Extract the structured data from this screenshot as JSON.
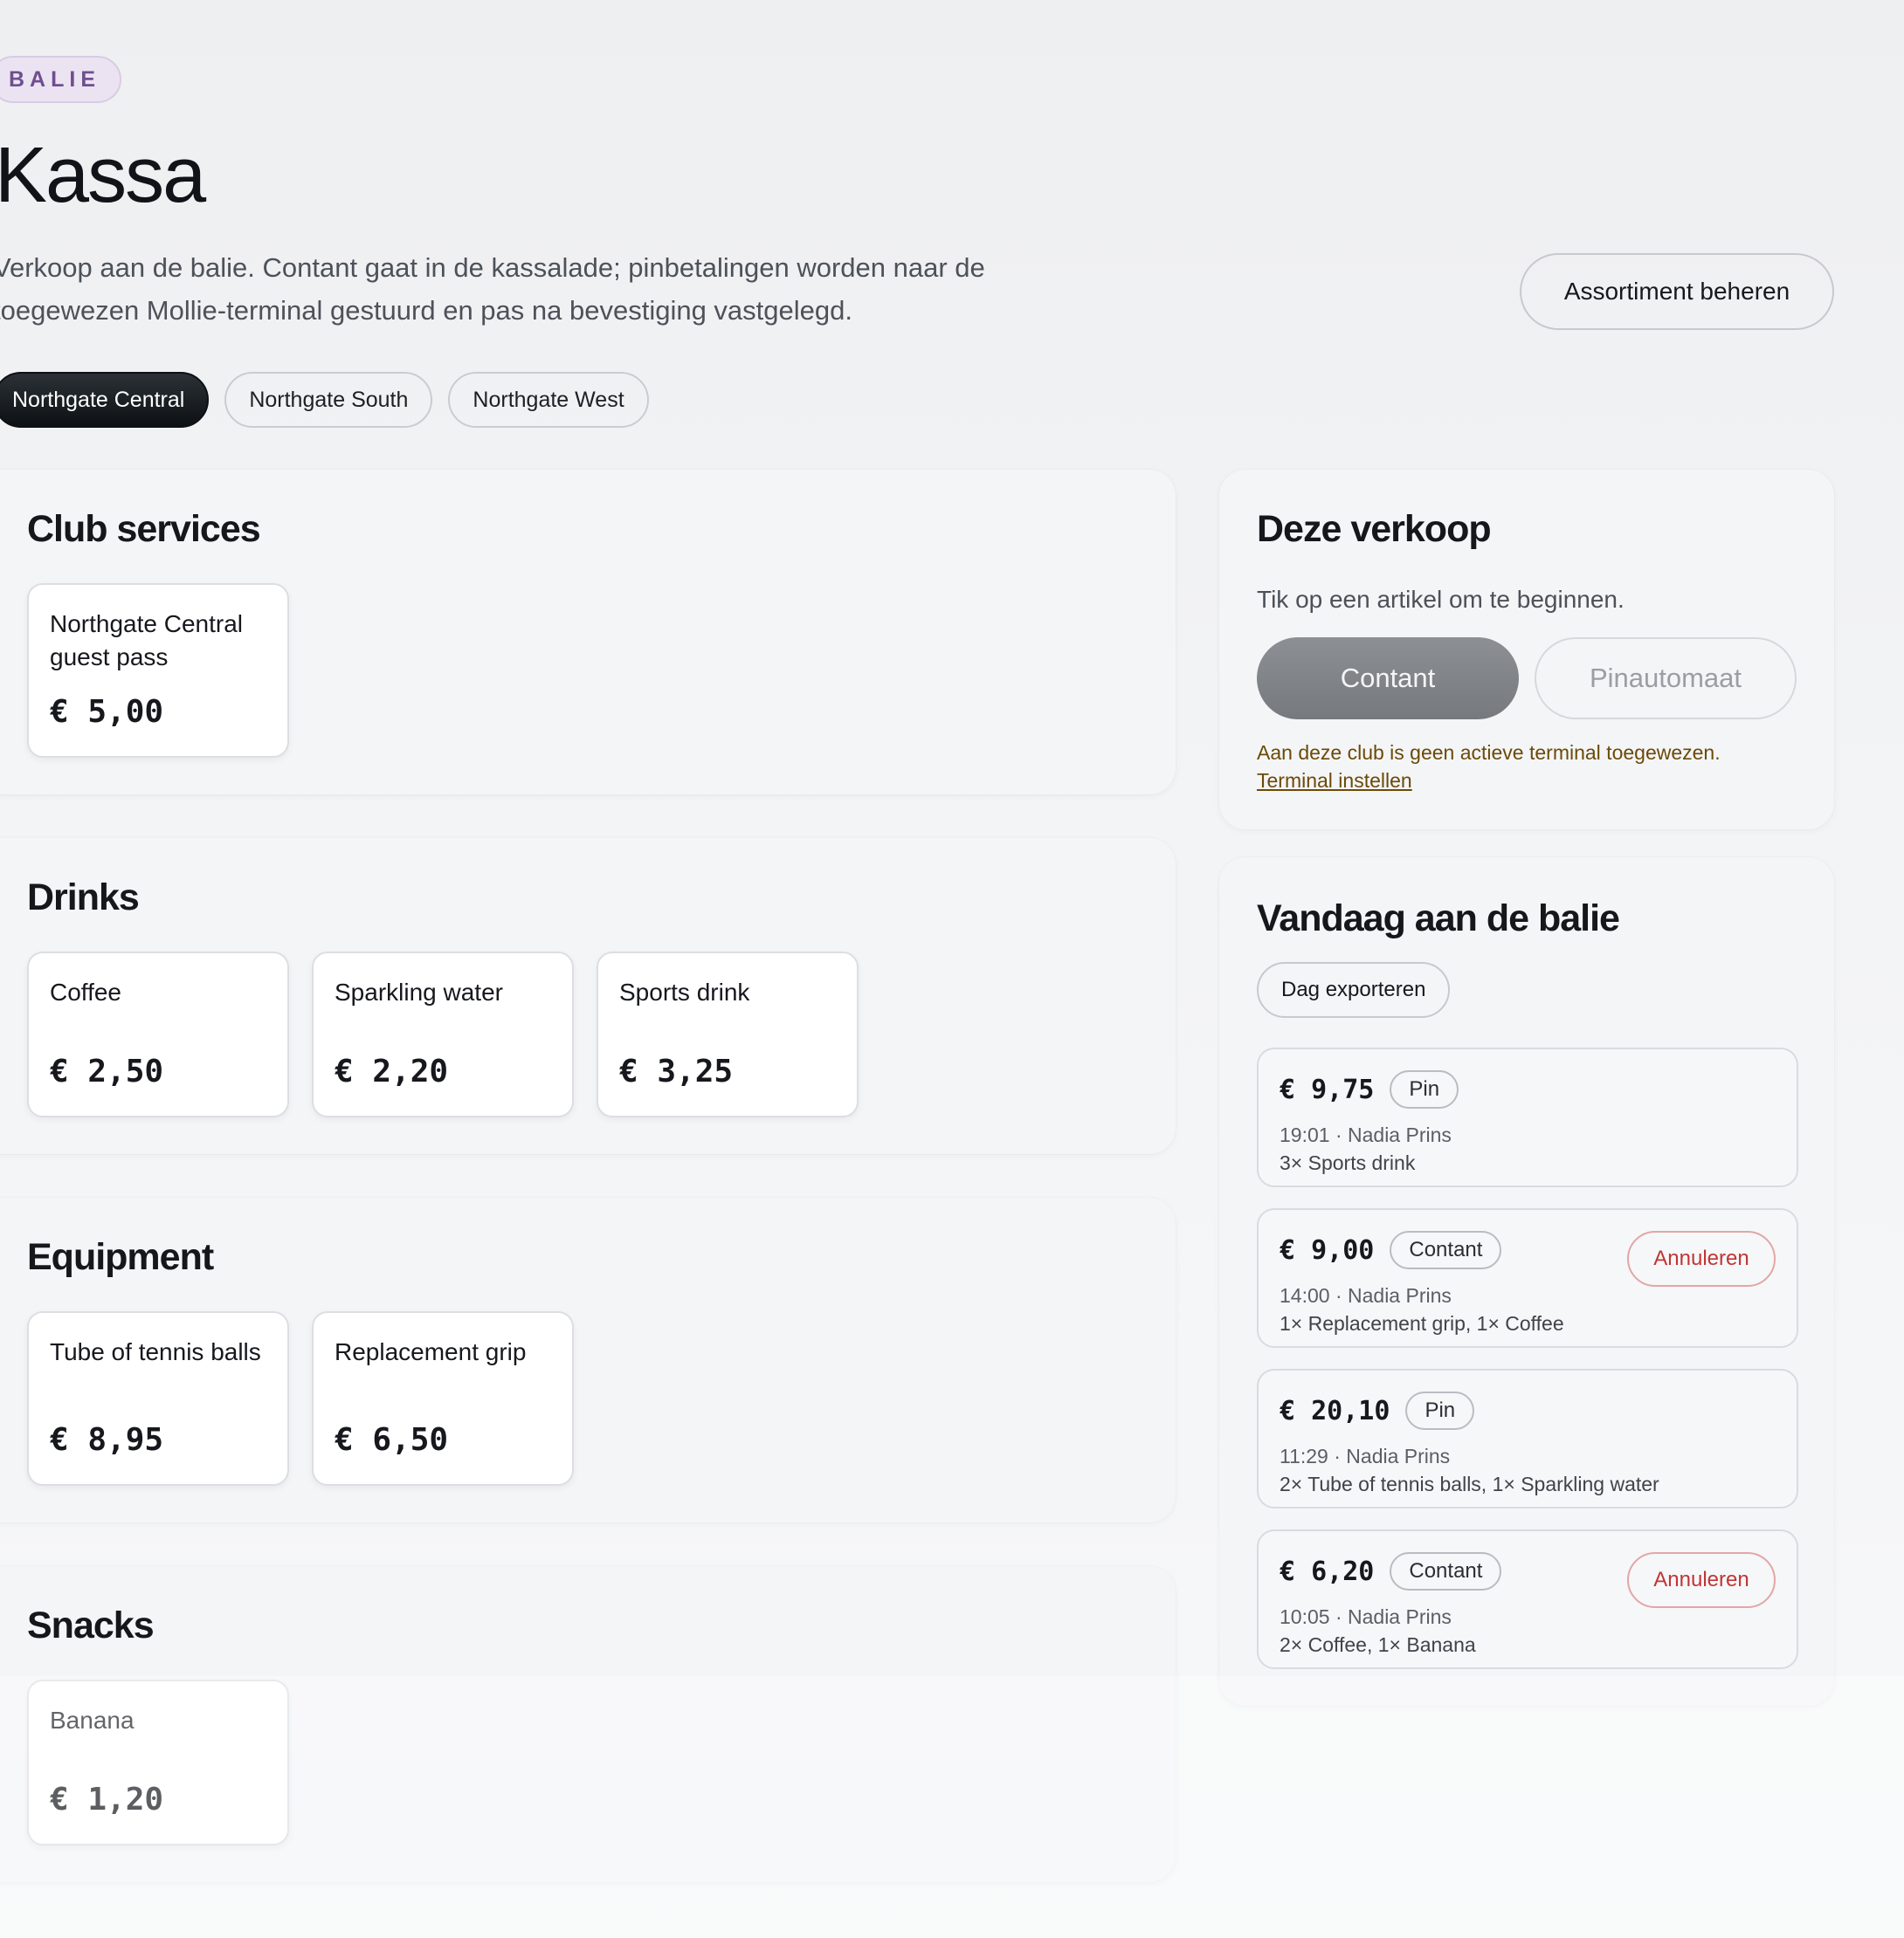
{
  "header": {
    "badge": "BALIE",
    "title": "Kassa",
    "description": "Verkoop aan de balie. Contant gaat in de kassalade; pinbetalingen worden naar de toegewezen Mollie-terminal gestuurd en pas na bevestiging vastgelegd.",
    "manage_button": "Assortiment beheren"
  },
  "clubs": [
    {
      "label": "Northgate Central",
      "active": true
    },
    {
      "label": "Northgate South",
      "active": false
    },
    {
      "label": "Northgate West",
      "active": false
    }
  ],
  "categories": [
    {
      "title": "Club services",
      "products": [
        {
          "name": "Northgate Central guest pass",
          "price": "€ 5,00"
        }
      ]
    },
    {
      "title": "Drinks",
      "products": [
        {
          "name": "Coffee",
          "price": "€ 2,50"
        },
        {
          "name": "Sparkling water",
          "price": "€ 2,20"
        },
        {
          "name": "Sports drink",
          "price": "€ 3,25"
        }
      ]
    },
    {
      "title": "Equipment",
      "products": [
        {
          "name": "Tube of tennis balls",
          "price": "€ 8,95"
        },
        {
          "name": "Replacement grip",
          "price": "€ 6,50"
        }
      ]
    },
    {
      "title": "Snacks",
      "products": [
        {
          "name": "Banana",
          "price": "€ 1,20"
        }
      ]
    }
  ],
  "current_sale": {
    "title": "Deze verkoop",
    "hint": "Tik op een artikel om te beginnen.",
    "cash_button": "Contant",
    "terminal_button": "Pinautomaat",
    "warning": "Aan deze club is geen actieve terminal toegewezen.",
    "warning_link": "Terminal instellen"
  },
  "today": {
    "title": "Vandaag aan de balie",
    "export_button": "Dag exporteren",
    "cancel_label": "Annuleren",
    "sales": [
      {
        "amount": "€ 9,75",
        "method": "Pin",
        "meta": "19:01 · Nadia Prins",
        "items": "3× Sports drink",
        "cancellable": false
      },
      {
        "amount": "€ 9,00",
        "method": "Contant",
        "meta": "14:00 · Nadia Prins",
        "items": "1× Replacement grip, 1× Coffee",
        "cancellable": true
      },
      {
        "amount": "€ 20,10",
        "method": "Pin",
        "meta": "11:29 · Nadia Prins",
        "items": "2× Tube of tennis balls, 1× Sparkling water",
        "cancellable": false
      },
      {
        "amount": "€ 6,20",
        "method": "Contant",
        "meta": "10:05 · Nadia Prins",
        "items": "2× Coffee, 1× Banana",
        "cancellable": true
      }
    ]
  }
}
